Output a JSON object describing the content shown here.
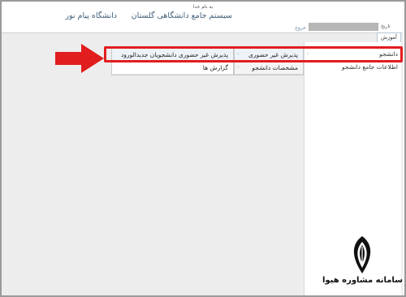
{
  "header": {
    "blessing": "به نام خدا",
    "site_title": "سیستم جامع دانشگاهی گلستان",
    "university": "دانشگاه پیام نور"
  },
  "info_bar": {
    "exit_label": "خروج",
    "date_label": "تاریخ"
  },
  "top_tab": {
    "label": "آموزش"
  },
  "menu": {
    "level1": [
      {
        "label": "دانشجو"
      },
      {
        "label": "اطلاعات جامع دانشجو"
      }
    ],
    "level2": [
      {
        "label": "پذیرش غیر حضوری"
      },
      {
        "label": "مشخصات دانشجو"
      }
    ],
    "level3": [
      {
        "label": "پذیرش غیر حضوری دانشجویان جدیدالورود"
      },
      {
        "label": "گزارش ها"
      }
    ]
  },
  "logo": {
    "text": "سامانه مشاوره هیوا"
  },
  "colors": {
    "highlight": "#e11d1d",
    "header_text": "#3f5d78",
    "panel_bg": "#ededed"
  }
}
